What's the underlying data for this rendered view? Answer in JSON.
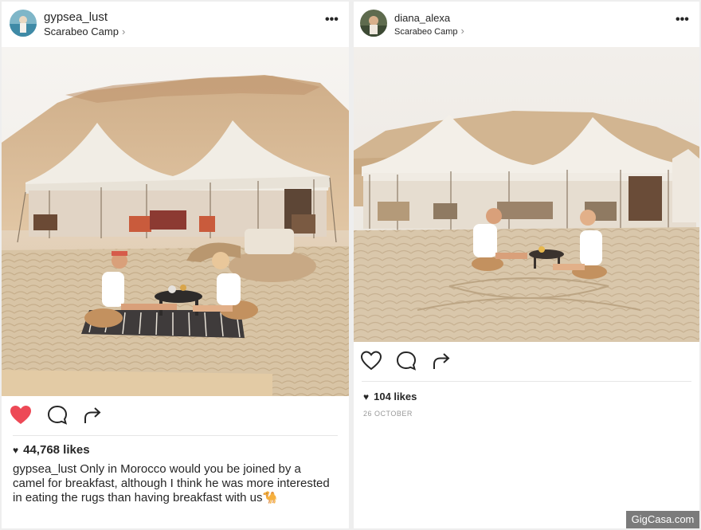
{
  "left_post": {
    "username": "gypsea_lust",
    "location": "Scarabeo Camp",
    "more_label": "•••",
    "likes": "44,768 likes",
    "caption_user": "gypsea_lust",
    "caption_text": "Only in Morocco would you be joined by a camel for breakfast, although I think he was more interested in eating the rugs than having breakfast with us",
    "caption_emoji": "🐪",
    "liked": true,
    "heart_color": "#ed4956"
  },
  "right_post": {
    "username": "diana_alexa",
    "location": "Scarabeo Camp",
    "more_label": "•••",
    "likes": "104 likes",
    "date": "26 OCTOBER",
    "liked": false
  },
  "watermark": "GigCasa.com",
  "icons": {
    "heart": "heart-icon",
    "comment": "comment-icon",
    "share": "share-icon",
    "chevron": "chevron-right-icon",
    "more": "more-options-icon"
  }
}
